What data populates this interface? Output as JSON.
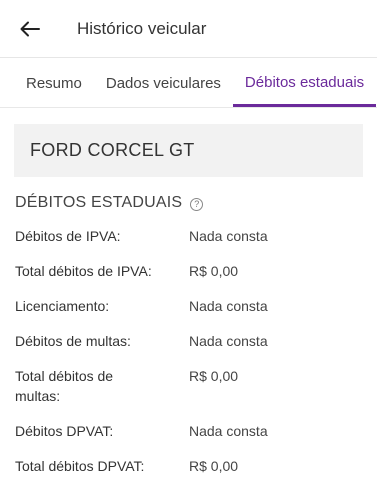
{
  "header": {
    "title": "Histórico veicular"
  },
  "tabs": [
    {
      "label": "Resumo"
    },
    {
      "label": "Dados veiculares"
    },
    {
      "label": "Débitos estaduais"
    }
  ],
  "vehicle": {
    "name": "FORD CORCEL GT"
  },
  "section": {
    "title": "DÉBITOS ESTADUAIS"
  },
  "rows": [
    {
      "label": "Débitos de IPVA:",
      "value": "Nada consta"
    },
    {
      "label": "Total débitos de IPVA:",
      "value": "R$ 0,00"
    },
    {
      "label": "Licenciamento:",
      "value": "Nada consta"
    },
    {
      "label": "Débitos de multas:",
      "value": "Nada consta"
    },
    {
      "label": "Total débitos de multas:",
      "value": "R$ 0,00"
    },
    {
      "label": "Débitos DPVAT:",
      "value": "Nada consta"
    },
    {
      "label": "Total débitos DPVAT:",
      "value": "R$ 0,00"
    }
  ],
  "colors": {
    "accent": "#6b2a9b",
    "box": "#f2f2f2"
  },
  "icons": {
    "back": "arrow-left-icon",
    "help": "help-circle-icon"
  }
}
